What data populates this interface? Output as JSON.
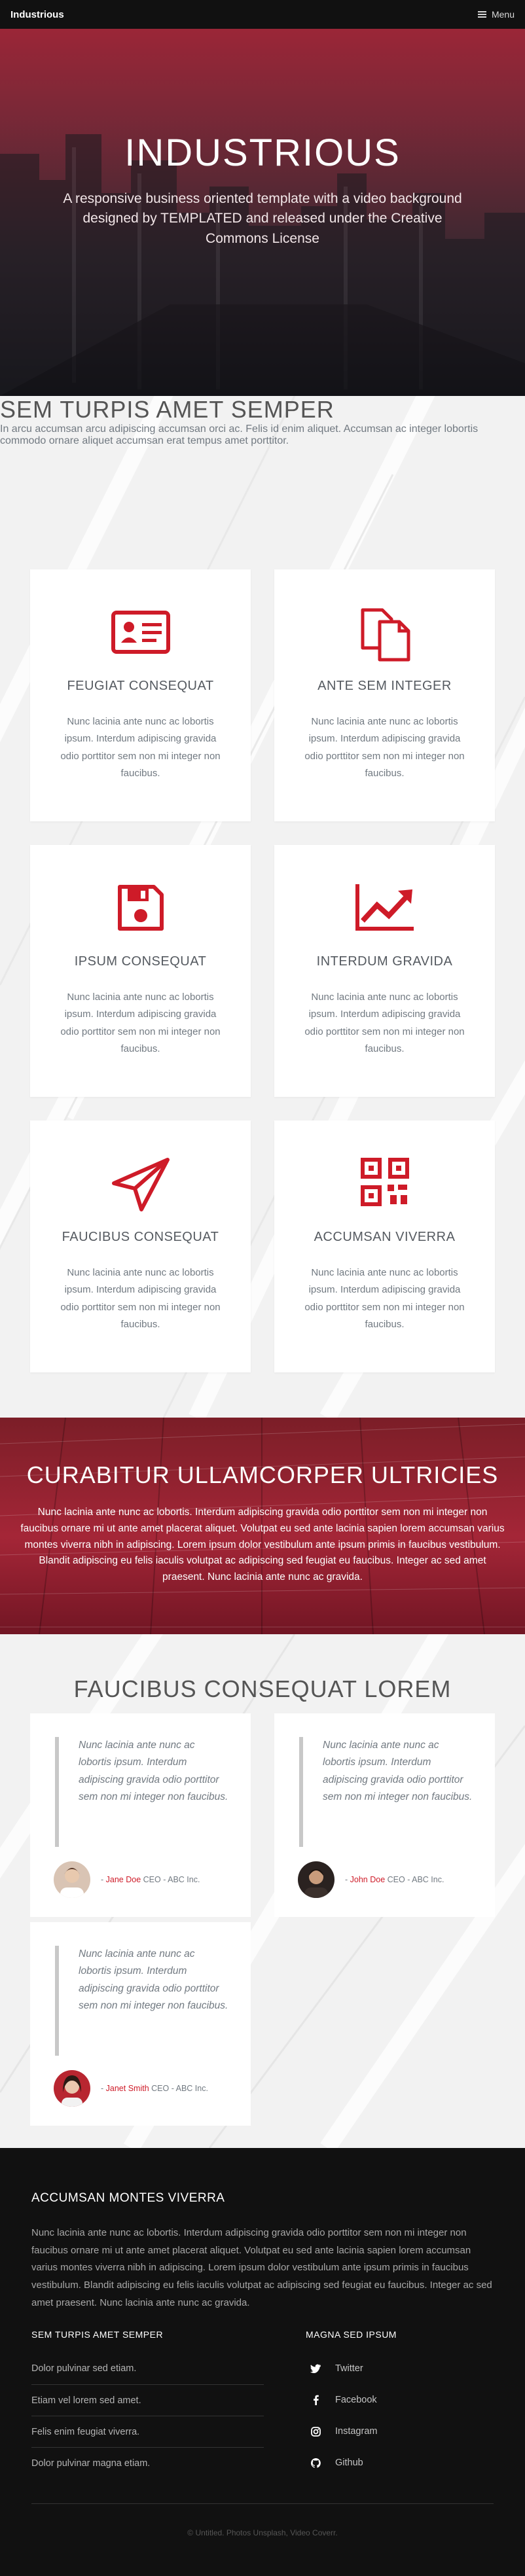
{
  "header": {
    "logo": "Industrious",
    "menu_label": "Menu"
  },
  "banner": {
    "title": "INDUSTRIOUS",
    "subtitle_line1": "A responsive business oriented template with a video background",
    "subtitle_line2": "designed by TEMPLATED and released under the Creative Commons License"
  },
  "features": {
    "title": "SEM TURPIS AMET SEMPER",
    "intro": "In arcu accumsan arcu adipiscing accumsan orci ac. Felis id enim aliquet. Accumsan ac integer lobortis commodo ornare aliquet accumsan erat tempus amet porttitor.",
    "items": [
      {
        "icon": "id-card-icon",
        "title": "FEUGIAT CONSEQUAT",
        "text": "Nunc lacinia ante nunc ac lobortis ipsum. Interdum adipiscing gravida odio porttitor sem non mi integer non faucibus."
      },
      {
        "icon": "copy-documents-icon",
        "title": "ANTE SEM INTEGER",
        "text": "Nunc lacinia ante nunc ac lobortis ipsum. Interdum adipiscing gravida odio porttitor sem non mi integer non faucibus."
      },
      {
        "icon": "floppy-disk-icon",
        "title": "IPSUM CONSEQUAT",
        "text": "Nunc lacinia ante nunc ac lobortis ipsum. Interdum adipiscing gravida odio porttitor sem non mi integer non faucibus."
      },
      {
        "icon": "line-chart-icon",
        "title": "INTERDUM GRAVIDA",
        "text": "Nunc lacinia ante nunc ac lobortis ipsum. Interdum adipiscing gravida odio porttitor sem non mi integer non faucibus."
      },
      {
        "icon": "paper-plane-icon",
        "title": "FAUCIBUS CONSEQUAT",
        "text": "Nunc lacinia ante nunc ac lobortis ipsum. Interdum adipiscing gravida odio porttitor sem non mi integer non faucibus."
      },
      {
        "icon": "qr-code-icon",
        "title": "ACCUMSAN VIVERRA",
        "text": "Nunc lacinia ante nunc ac lobortis ipsum. Interdum adipiscing gravida odio porttitor sem non mi integer non faucibus."
      }
    ]
  },
  "cta": {
    "title": "CURABITUR ULLAMCORPER ULTRICIES",
    "text": "Nunc lacinia ante nunc ac lobortis. Interdum adipiscing gravida odio porttitor sem non mi integer non faucibus ornare mi ut ante amet placerat aliquet. Volutpat eu sed ante lacinia sapien lorem accumsan varius montes viverra nibh in adipiscing. Lorem ipsum dolor vestibulum ante ipsum primis in faucibus vestibulum. Blandit adipiscing eu felis iaculis volutpat ac adipiscing sed feugiat eu faucibus. Integer ac sed amet praesent. Nunc lacinia ante nunc ac gravida."
  },
  "testimonials": {
    "title": "FAUCIBUS CONSEQUAT LOREM",
    "items": [
      {
        "quote": "Nunc lacinia ante nunc ac lobortis ipsum. Interdum adipiscing gravida odio porttitor sem non mi integer non faucibus.",
        "prefix": "- ",
        "name": "Jane Doe",
        "role": " CEO - ABC Inc."
      },
      {
        "quote": "Nunc lacinia ante nunc ac lobortis ipsum. Interdum adipiscing gravida odio porttitor sem non mi integer non faucibus.",
        "prefix": "- ",
        "name": "John Doe",
        "role": " CEO - ABC Inc."
      },
      {
        "quote": "Nunc lacinia ante nunc ac lobortis ipsum. Interdum adipiscing gravida odio porttitor sem non mi integer non faucibus.",
        "prefix": "- ",
        "name": "Janet Smith",
        "role": " CEO - ABC Inc."
      }
    ]
  },
  "footer": {
    "title": "ACCUMSAN MONTES VIVERRA",
    "text": "Nunc lacinia ante nunc ac lobortis. Interdum adipiscing gravida odio porttitor sem non mi integer non faucibus ornare mi ut ante amet placerat aliquet. Volutpat eu sed ante lacinia sapien lorem accumsan varius montes viverra nibh in adipiscing. Lorem ipsum dolor vestibulum ante ipsum primis in faucibus vestibulum. Blandit adipiscing eu felis iaculis volutpat ac adipiscing sed feugiat eu faucibus. Integer ac sed amet praesent. Nunc lacinia ante nunc ac gravida.",
    "links_title": "SEM TURPIS AMET SEMPER",
    "links": [
      "Dolor pulvinar sed etiam.",
      "Etiam vel lorem sed amet.",
      "Felis enim feugiat viverra.",
      "Dolor pulvinar magna etiam."
    ],
    "social_title": "MAGNA SED IPSUM",
    "social": [
      {
        "icon": "twitter-icon",
        "label": "Twitter"
      },
      {
        "icon": "facebook-icon",
        "label": "Facebook"
      },
      {
        "icon": "instagram-icon",
        "label": "Instagram"
      },
      {
        "icon": "github-icon",
        "label": "Github"
      }
    ],
    "copyright": "© Untitled. Photos Unsplash, Video Coverr."
  },
  "colors": {
    "accent": "#ce1b28",
    "header_bg": "#111111",
    "footer_bg": "#111111",
    "section_bg": "#f2f2f2"
  }
}
